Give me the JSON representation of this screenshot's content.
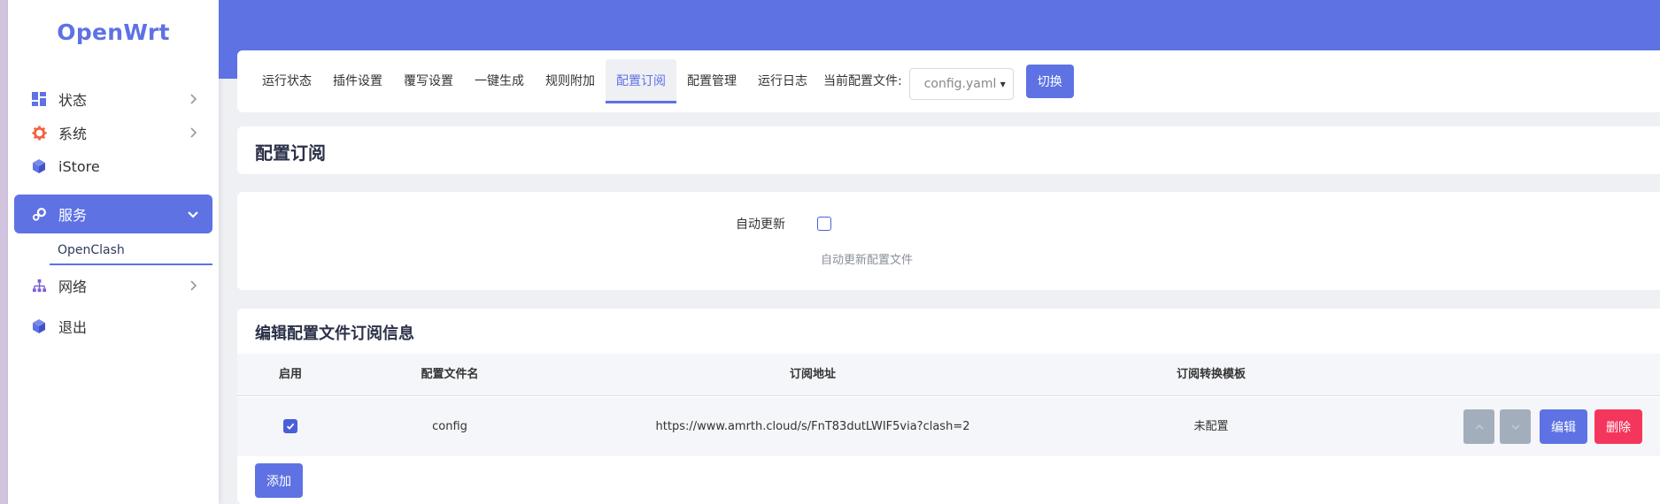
{
  "app": {
    "logo": "OpenWrt"
  },
  "sidebar": {
    "items": [
      {
        "label": "状态",
        "icon": "dashboard-icon"
      },
      {
        "label": "系统",
        "icon": "gear-icon"
      },
      {
        "label": "iStore",
        "icon": "cube-icon"
      },
      {
        "label": "服务",
        "icon": "services-icon"
      },
      {
        "label": "网络",
        "icon": "network-icon"
      },
      {
        "label": "退出",
        "icon": "cube-icon"
      }
    ],
    "active_subitem": "OpenClash"
  },
  "tabs": [
    {
      "label": "运行状态"
    },
    {
      "label": "插件设置"
    },
    {
      "label": "覆写设置"
    },
    {
      "label": "一键生成"
    },
    {
      "label": "规则附加"
    },
    {
      "label": "配置订阅"
    },
    {
      "label": "配置管理"
    },
    {
      "label": "运行日志"
    }
  ],
  "active_tab": "配置订阅",
  "config": {
    "label": "当前配置文件:",
    "selected": "config.yaml",
    "switch_label": "切换"
  },
  "page_title": "配置订阅",
  "auto_update": {
    "label": "自动更新",
    "checked": false,
    "description": "自动更新配置文件"
  },
  "subscriptions": {
    "title": "编辑配置文件订阅信息",
    "columns": [
      "启用",
      "配置文件名",
      "订阅地址",
      "订阅转换模板"
    ],
    "rows": [
      {
        "enabled": true,
        "name": "config",
        "url": "https://www.amrth.cloud/s/FnT83dutLWIF5via?clash=2",
        "template": "未配置"
      }
    ],
    "edit_label": "编辑",
    "delete_label": "删除",
    "add_label": "添加"
  },
  "colors": {
    "accent": "#5e72e4",
    "danger": "#f5365c",
    "gray_button": "#a3aebd"
  }
}
